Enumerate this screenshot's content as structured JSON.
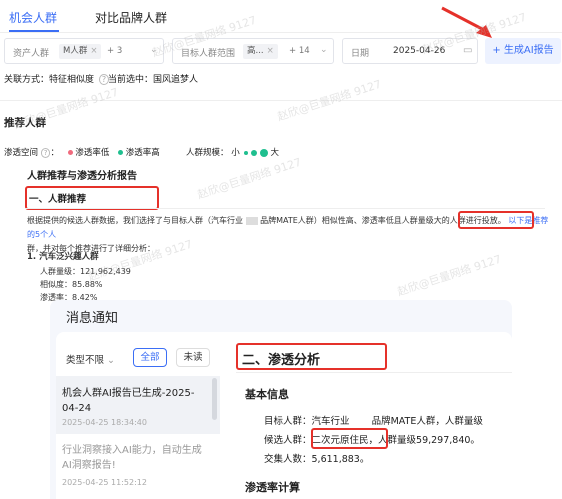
{
  "tabs": [
    {
      "label": "机会人群"
    },
    {
      "label": "对比品牌人群"
    }
  ],
  "filters": {
    "asset_placeholder": "资产人群",
    "asset_tag": "M人群",
    "asset_more": "+ 3",
    "target_placeholder": "目标人群范围",
    "target_tag": "高...",
    "target_more": "+ 14",
    "date_label": "日期",
    "date_value": "2025-04-26",
    "generate_button": "+ 生成AI报告"
  },
  "association": {
    "method_label": "关联方式：特征相似度",
    "current_label": "当前选中：国风追梦人"
  },
  "recommend": {
    "title": "推荐人群",
    "penetration_label": "渗透空间",
    "low_label": "渗透率低",
    "high_label": "渗透率高",
    "scale_label": "人群规模：",
    "small": "小",
    "large": "大"
  },
  "report": {
    "title": "人群推荐与渗透分析报告",
    "section1": "一、人群推荐",
    "paragraph_a": "根据提供的候选人群数据，我们选择了与目标人群（汽车行业",
    "paragraph_b": "品牌MATE人群）相似性高、渗透率低且人群量级大的人群进行投放。",
    "highlight": "以下是推荐的5个人",
    "paragraph_c": "群，并对每个推荐进行了详细分析：",
    "item_title": "1. 汽车泛兴趣人群",
    "stats": [
      {
        "label": "人群量级：",
        "value": "121,962,439"
      },
      {
        "label": "相似度：",
        "value": "85.88%"
      },
      {
        "label": "渗透率：",
        "value": "8.42%"
      }
    ]
  },
  "notice": {
    "title": "消息通知",
    "type_filter": "类型不限",
    "all_button": "全部",
    "unread_button": "未读",
    "items": [
      {
        "title": "机会人群AI报告已生成-2025-04-24",
        "time": "2025-04-25 18:34:40"
      },
      {
        "title": "行业洞察接入AI能力，自动生成AI洞察报告!",
        "time": "2025-04-25 11:52:12"
      }
    ],
    "section2": "二、渗透分析",
    "basic_title": "基本信息",
    "target_row_a": "目标人群：汽车行业",
    "target_row_b": "品牌MATE人群，人群量级",
    "candidate_label": "候选人群：",
    "candidate_value": "二次元原住民",
    "candidate_rest": "，人群量级59,297,840。",
    "overlap": "交集人数：5,611,883。",
    "rate_title": "渗透率计算"
  },
  "watermark": "赵欣@巨量网络 9127",
  "colors": {
    "accent": "#3b6ef5",
    "red": "#e5312a",
    "low": "#f06a7d",
    "high": "#1fbf8f"
  }
}
